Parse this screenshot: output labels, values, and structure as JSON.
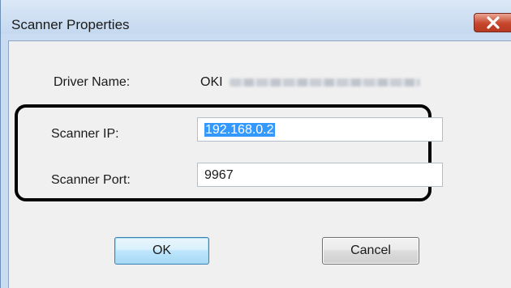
{
  "window": {
    "title": "Scanner Properties",
    "close_icon": "close-icon"
  },
  "form": {
    "driver_name_label": "Driver Name:",
    "driver_name_value": "OKI",
    "scanner_ip_label": "Scanner IP:",
    "scanner_ip_value": "192.168.0.2",
    "scanner_port_label": "Scanner Port:",
    "scanner_port_value": "9967"
  },
  "buttons": {
    "ok_label": "OK",
    "cancel_label": "Cancel"
  },
  "colors": {
    "titlebar": "#c4d8ef",
    "close_button": "#c7462c",
    "selection": "#3399ff",
    "annotation_box": "#000000"
  }
}
